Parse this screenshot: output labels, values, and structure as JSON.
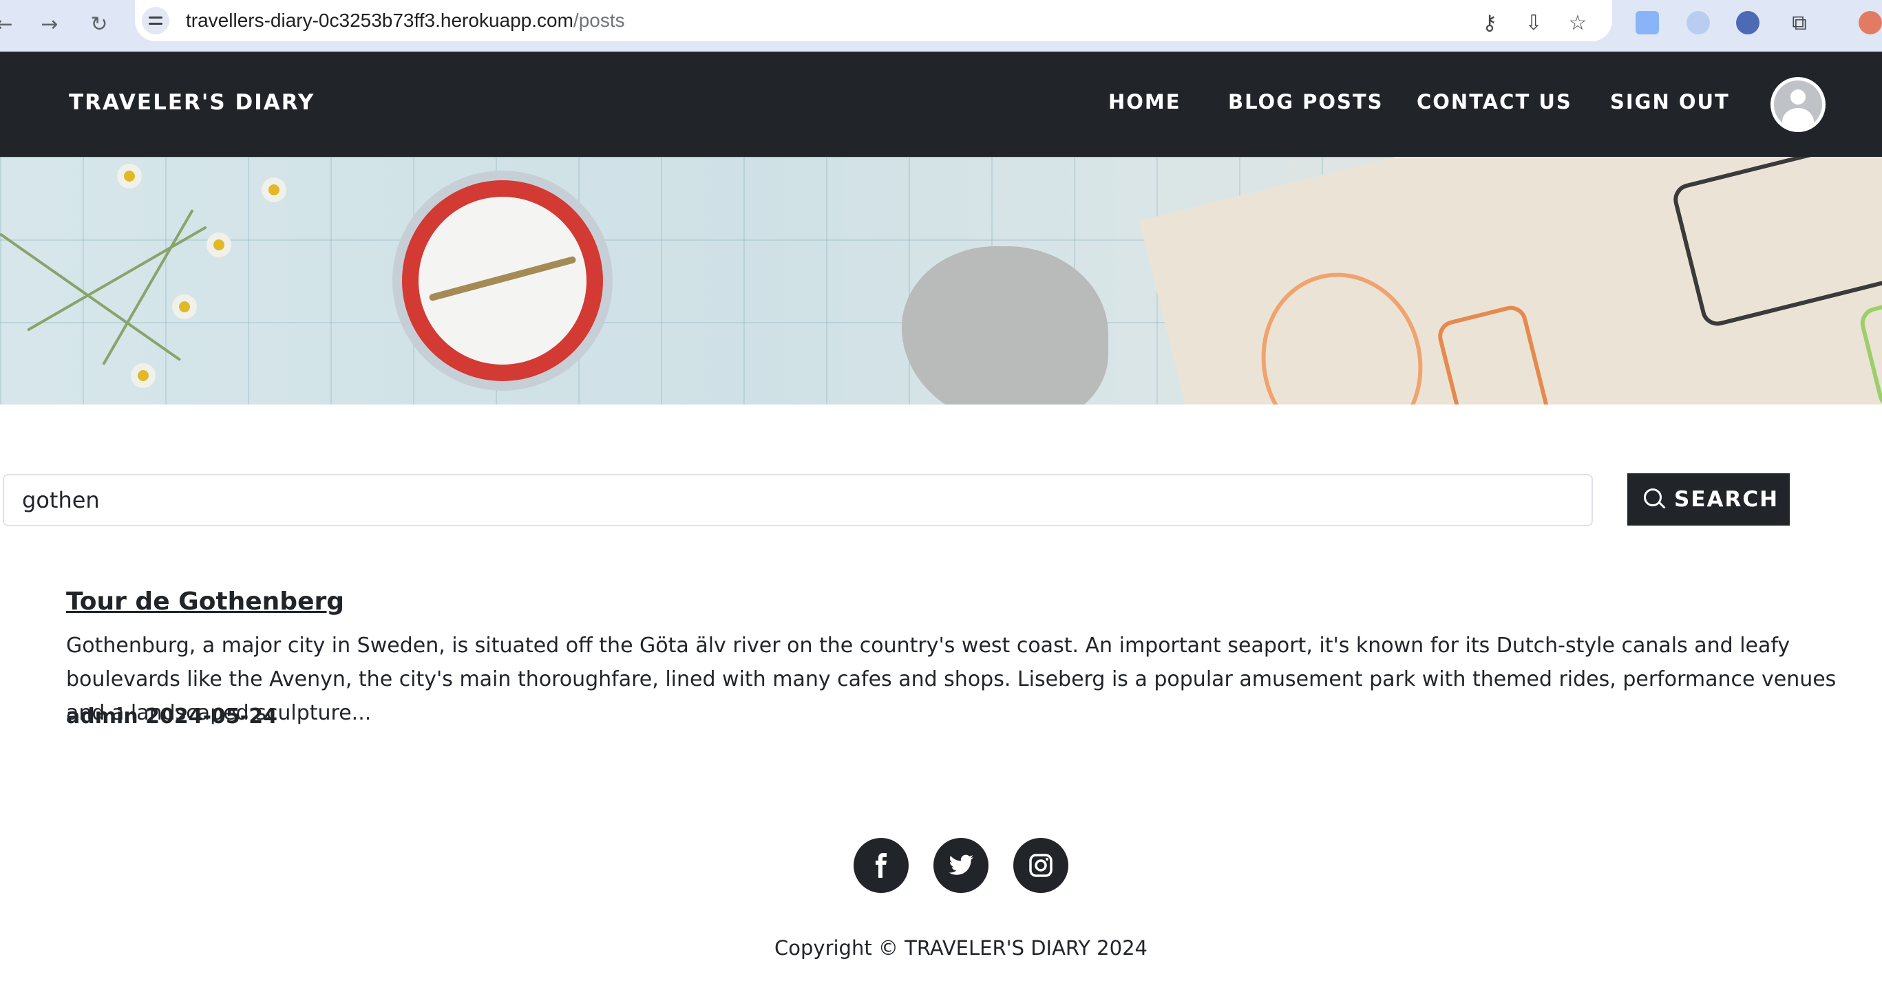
{
  "browser": {
    "url_host": "travellers-diary-0c3253b73ff3.herokuapp.com",
    "url_path": "/posts",
    "icons": [
      "back-icon",
      "forward-icon",
      "reload-icon",
      "site-info-icon",
      "password-key-icon",
      "install-app-icon",
      "bookmark-star-icon",
      "translate-extension-icon",
      "extension-icon",
      "extension-icon",
      "extensions-puzzle-icon",
      "profile-icon"
    ]
  },
  "header": {
    "brand": "TRAVELER'S DIARY",
    "nav": {
      "home": "HOME",
      "blog_posts": "BLOG POSTS",
      "contact_us": "CONTACT US",
      "sign_out": "SIGN OUT"
    }
  },
  "search": {
    "value": "gothen",
    "button_label": "SEARCH"
  },
  "posts": [
    {
      "title": "Tour de Gothenberg",
      "excerpt": "Gothenburg, a major city in Sweden, is situated off the Göta älv river on the country's west coast. An important seaport, it's known for its Dutch-style canals and leafy boulevards like the Avenyn, the city's main thoroughfare, lined with many cafes and shops. Liseberg is a popular amusement park with themed rides, performance venues and a landscaped sculpture...",
      "author": "admin",
      "date": "2024-05-24"
    }
  ],
  "footer": {
    "social": [
      "facebook-icon",
      "twitter-icon",
      "instagram-icon"
    ],
    "copyright": "Copyright © TRAVELER'S DIARY 2024"
  },
  "colors": {
    "header_bg": "#212529",
    "text": "#212529",
    "browser_bar": "#dfe7f6"
  }
}
